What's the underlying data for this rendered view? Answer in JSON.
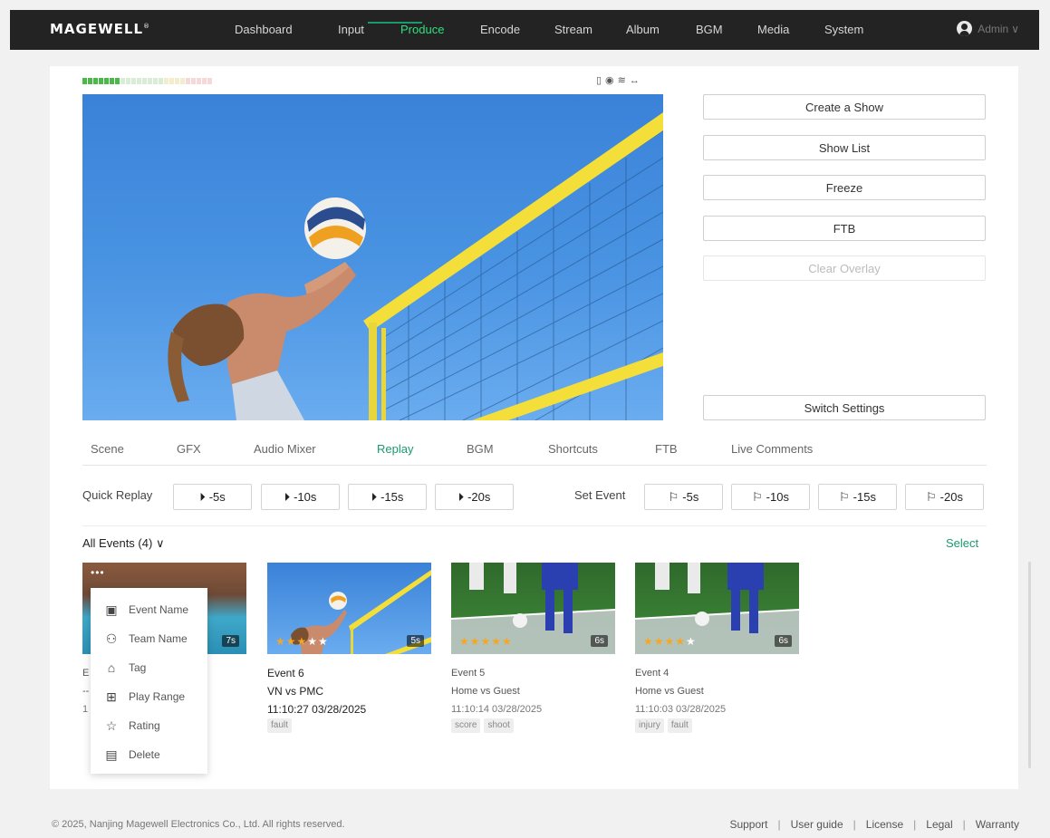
{
  "app": {
    "logo": "MAGEWELL",
    "logo_mark": "®"
  },
  "nav": {
    "items": [
      "Dashboard",
      "Input",
      "Produce",
      "Encode",
      "Stream",
      "Album",
      "BGM",
      "Media",
      "System"
    ],
    "active": "Produce",
    "active_color": "#2ee07e"
  },
  "user": {
    "name": "Admin",
    "chevron": "∨"
  },
  "preview": {
    "status_icons": [
      "sd-card-icon",
      "camera-icon",
      "wifi-icon",
      "link-icon"
    ],
    "status_glyphs": "▯◉≋↔",
    "audio_meter_level": 0.3
  },
  "side_buttons": {
    "create_show": "Create a Show",
    "show_list": "Show List",
    "freeze": "Freeze",
    "ftb": "FTB",
    "clear_overlay": "Clear Overlay",
    "switch_settings": "Switch Settings"
  },
  "tabs": {
    "items": [
      "Scene",
      "GFX",
      "Audio Mixer",
      "Replay",
      "BGM",
      "Shortcuts",
      "FTB",
      "Live Comments"
    ],
    "active": "Replay",
    "accent": "#1a9a6c"
  },
  "quick_replay": {
    "label": "Quick Replay",
    "buttons": [
      "-5s",
      "-10s",
      "-15s",
      "-20s"
    ]
  },
  "set_event": {
    "label": "Set Event",
    "buttons": [
      "-5s",
      "-10s",
      "-15s",
      "-20s"
    ]
  },
  "events_header": {
    "filter": "All Events (4)",
    "chevron": "∨",
    "select": "Select"
  },
  "events": [
    {
      "title": "E",
      "teams": "--",
      "time": "1",
      "duration": "7s",
      "rating": 0,
      "tags": []
    },
    {
      "title": "Event 6",
      "teams": "VN vs PMC",
      "time": "11:10:27 03/28/2025",
      "duration": "5s",
      "rating": 3,
      "tags": [
        "fault"
      ]
    },
    {
      "title": "Event 5",
      "teams": "Home vs Guest",
      "time": "11:10:14 03/28/2025",
      "duration": "6s",
      "rating": 5,
      "tags": [
        "score",
        "shoot"
      ]
    },
    {
      "title": "Event 4",
      "teams": "Home vs Guest",
      "time": "11:10:03 03/28/2025",
      "duration": "6s",
      "rating": 4,
      "tags": [
        "injury",
        "fault"
      ]
    }
  ],
  "context_menu": {
    "items": [
      {
        "label": "Event Name",
        "icon": "event-name-icon",
        "glyph": "▣"
      },
      {
        "label": "Team Name",
        "icon": "team-icon",
        "glyph": "⚇"
      },
      {
        "label": "Tag",
        "icon": "tag-icon",
        "glyph": "⌂"
      },
      {
        "label": "Play Range",
        "icon": "play-range-icon",
        "glyph": "⊞"
      },
      {
        "label": "Rating",
        "icon": "star-icon",
        "glyph": "☆"
      },
      {
        "label": "Delete",
        "icon": "trash-icon",
        "glyph": "▤"
      }
    ]
  },
  "footer": {
    "copyright": "© 2025, Nanjing Magewell Electronics Co., Ltd. All rights reserved.",
    "links": [
      "Support",
      "User guide",
      "License",
      "Legal",
      "Warranty"
    ]
  }
}
